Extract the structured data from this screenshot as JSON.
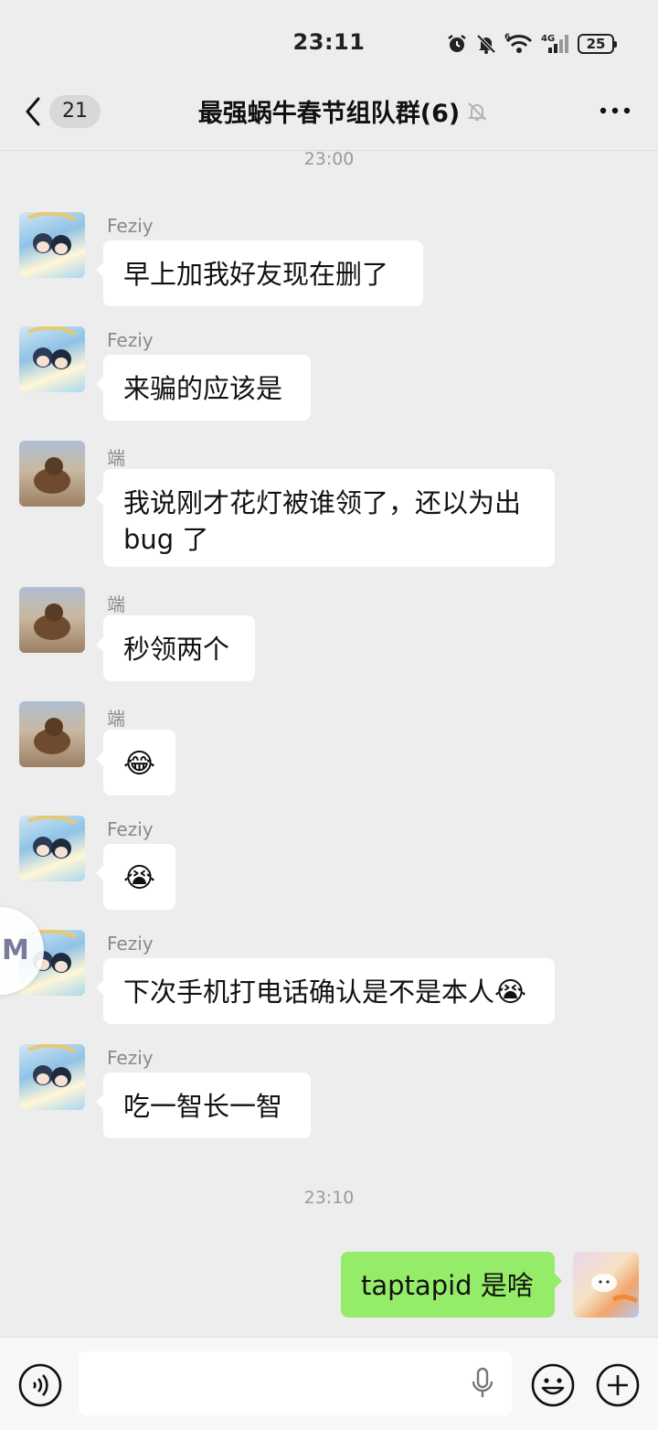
{
  "status_bar": {
    "time": "23:11",
    "network": "4G",
    "wifi_badge": "6",
    "battery": "25"
  },
  "header": {
    "unread_count": "21",
    "title": "最强蜗牛春节组队群(6)"
  },
  "messages": {
    "time_1": "23:00",
    "time_2": "23:10",
    "list": [
      {
        "sender": "Feziy",
        "text": "早上加我好友现在删了"
      },
      {
        "sender": "Feziy",
        "text": "来骗的应该是"
      },
      {
        "sender": "端",
        "line1": "我说刚才花灯被谁领了，还以为出",
        "line2": "bug 了"
      },
      {
        "sender": "端",
        "text": "秒领两个"
      },
      {
        "sender": "端",
        "emoji": "😂"
      },
      {
        "sender": "Feziy",
        "emoji": "😭"
      },
      {
        "sender": "Feziy",
        "text": "下次手机打电话确认是不是本人",
        "emoji": "😭"
      },
      {
        "sender": "Feziy",
        "text": "吃一智长一智"
      }
    ],
    "self": {
      "text": "taptapid 是啥"
    }
  },
  "floating_ball": {
    "label": "M"
  },
  "input_bar": {
    "placeholder": ""
  },
  "colors": {
    "background": "#ededed",
    "bubble_other": "#ffffff",
    "bubble_self": "#95ec69"
  }
}
